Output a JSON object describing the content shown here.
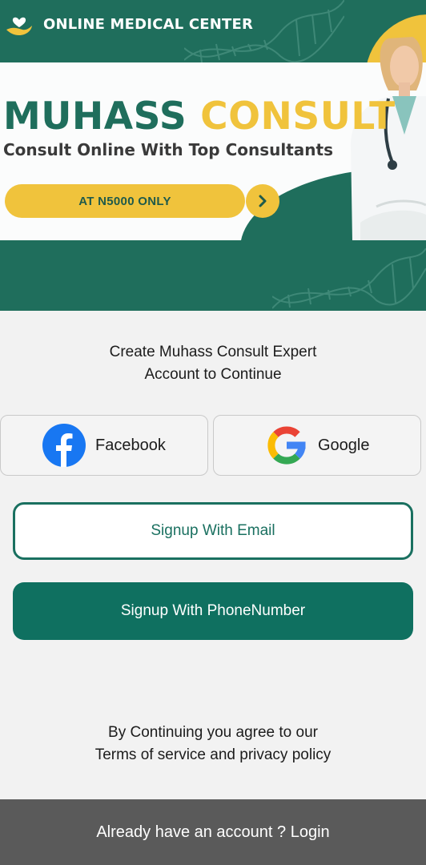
{
  "banner": {
    "brand": "ONLINE MEDICAL CENTER",
    "title_part1": "MUHASS",
    "title_part2": "CONSULT",
    "subtitle": "Consult Online With Top Consultants",
    "price": "AT N5000 ONLY"
  },
  "prompt": {
    "line1": "Create Muhass Consult Expert",
    "line2": "Account to Continue"
  },
  "social": {
    "facebook_label": "Facebook",
    "google_label": "Google"
  },
  "buttons": {
    "email": "Signup With Email",
    "phone": "Signup With PhoneNumber"
  },
  "terms": {
    "line1": "By Continuing you agree to our",
    "line2": "Terms of service and privacy policy"
  },
  "footer": {
    "login_text": "Already have an account ? Login"
  },
  "colors": {
    "brand_green": "#1f6e5c",
    "accent_yellow": "#f0c33c",
    "button_green": "#0f7060",
    "footer_gray": "#5a5a5a"
  },
  "icons": [
    "heart-hand-logo-icon",
    "chevron-right-icon",
    "facebook-icon",
    "google-icon"
  ]
}
